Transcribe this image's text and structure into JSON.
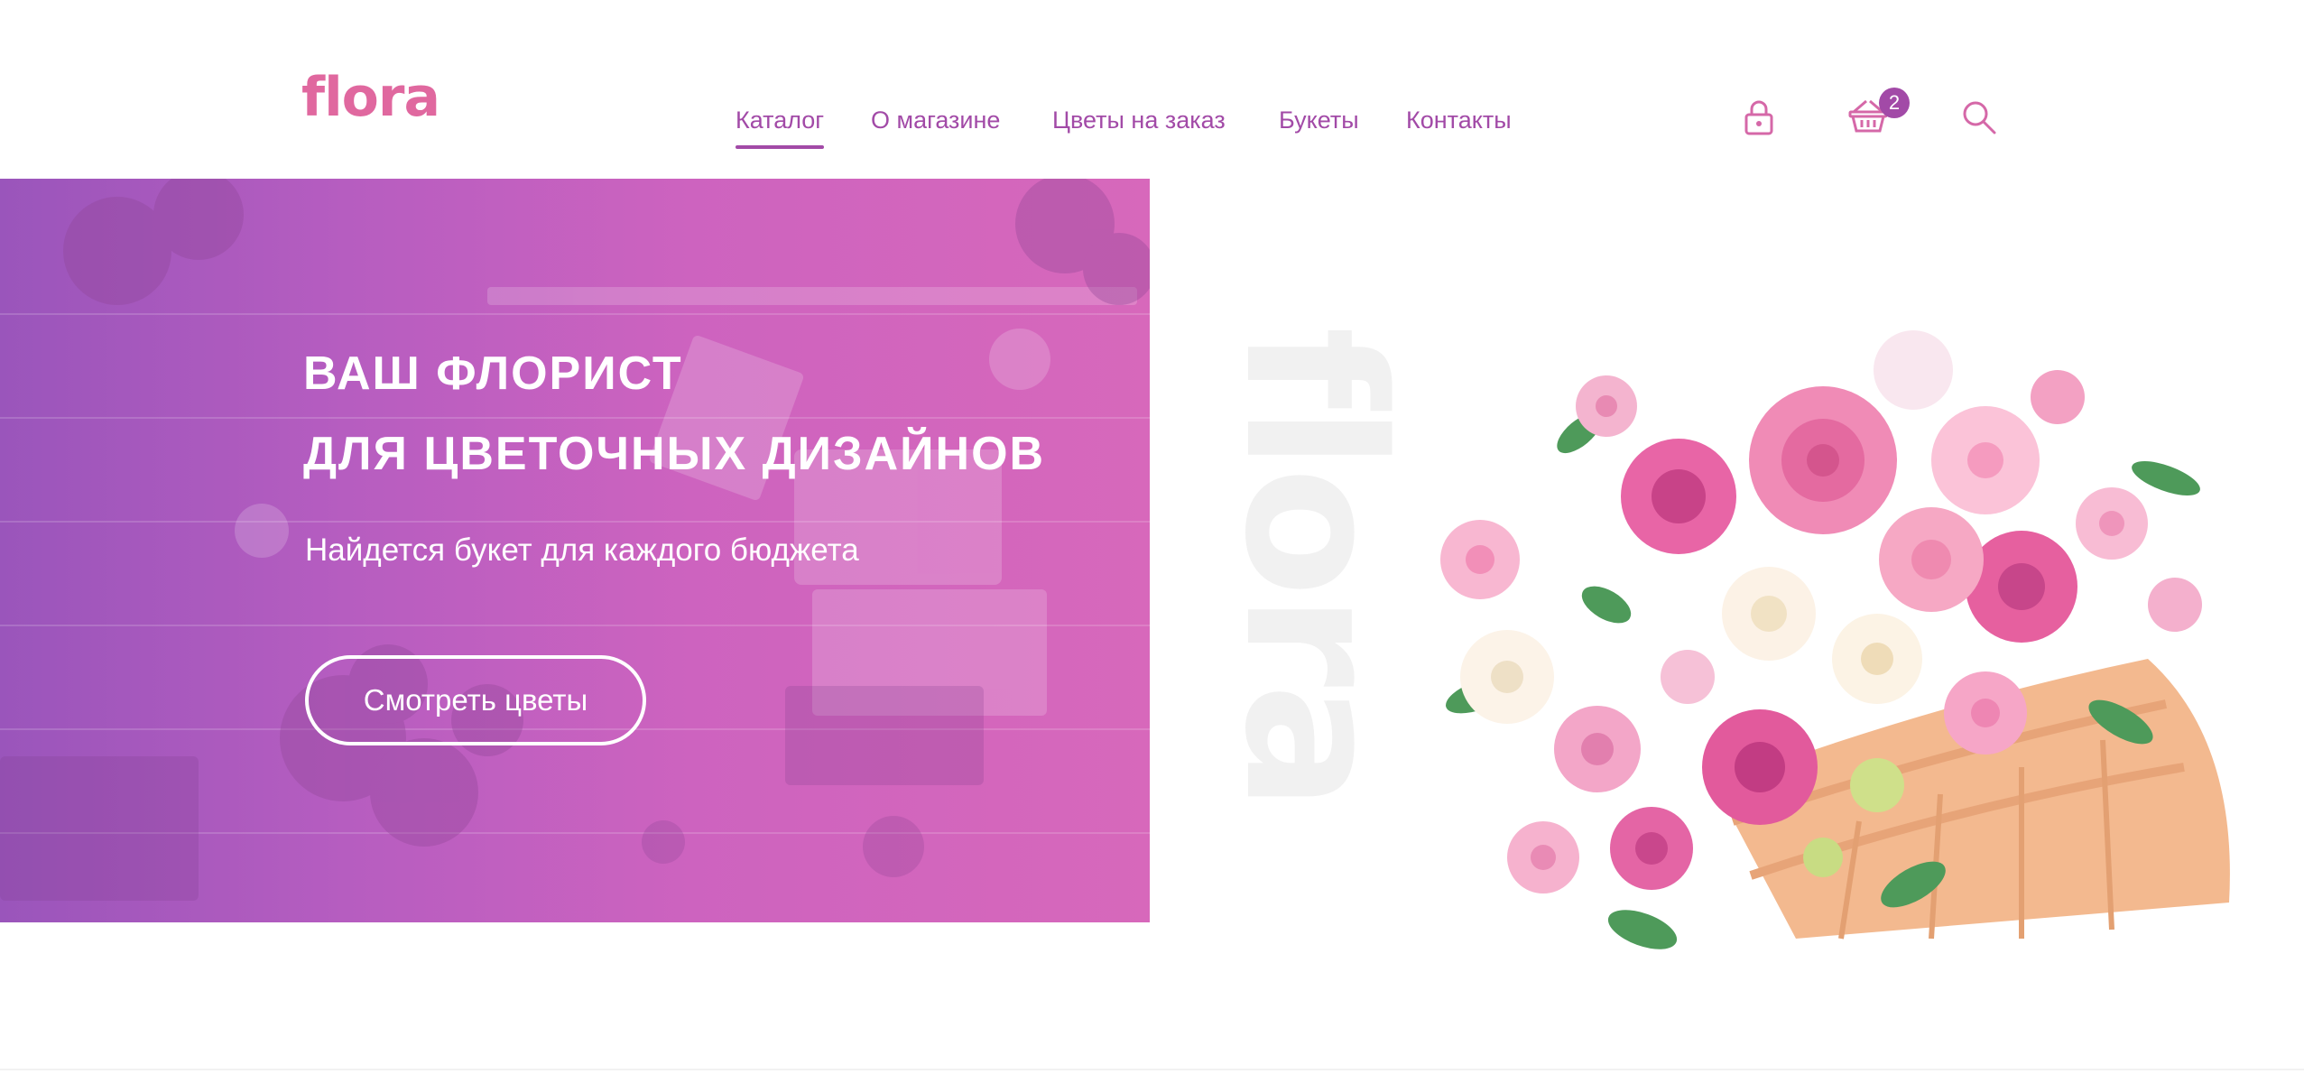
{
  "header": {
    "logo": "flora",
    "nav": [
      {
        "label": "Каталог",
        "active": true
      },
      {
        "label": "О магазине",
        "active": false
      },
      {
        "label": "Цветы на заказ",
        "active": false
      },
      {
        "label": "Букеты",
        "active": false
      },
      {
        "label": "Контакты",
        "active": false
      }
    ],
    "icons": {
      "account": "lock-icon",
      "cart": "basket-icon",
      "search": "search-icon"
    },
    "cart_count": "2"
  },
  "hero": {
    "title_line1": "ВАШ ФЛОРИСТ",
    "title_line2": "ДЛЯ ЦВЕТОЧНЫХ ДИЗАЙНОВ",
    "subtitle": "Найдется букет для каждого бюджета",
    "cta_label": "Смотреть цветы"
  },
  "watermark": "flora",
  "colors": {
    "accent": "#a24aa7",
    "logo": "#e0689f",
    "hero_overlay": "#c660c0"
  }
}
